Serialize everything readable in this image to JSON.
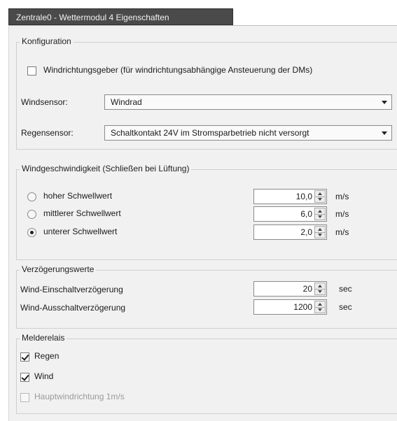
{
  "window": {
    "tab_title": "Zentrale0 - Wettermodul 4 Eigenschaften"
  },
  "konfiguration": {
    "title": "Konfiguration",
    "windrichtung_checkbox_label": "Windrichtungsgeber (für windrichtungsabhängige Ansteuerung der DMs)",
    "windrichtung_checked": false,
    "windsensor_label": "Windsensor:",
    "windsensor_value": "Windrad",
    "regensensor_label": "Regensensor:",
    "regensensor_value": "Schaltkontakt 24V im Stromsparbetrieb nicht versorgt"
  },
  "windgeschwindigkeit": {
    "title": "Windgeschwindigkeit (Schließen bei Lüftung)",
    "options": [
      {
        "label": "hoher Schwellwert",
        "value": "10,0",
        "unit": "m/s",
        "selected": false
      },
      {
        "label": "mittlerer Schwellwert",
        "value": "6,0",
        "unit": "m/s",
        "selected": false
      },
      {
        "label": "unterer Schwellwert",
        "value": "2,0",
        "unit": "m/s",
        "selected": true
      }
    ]
  },
  "verzoegerung": {
    "title": "Verzögerungswerte",
    "rows": [
      {
        "label": "Wind-Einschaltverzögerung",
        "value": "20",
        "unit": "sec"
      },
      {
        "label": "Wind-Ausschaltverzögerung",
        "value": "1200",
        "unit": "sec"
      }
    ]
  },
  "melderelais": {
    "title": "Melderelais",
    "items": [
      {
        "label": "Regen",
        "checked": true,
        "enabled": true
      },
      {
        "label": "Wind",
        "checked": true,
        "enabled": true
      },
      {
        "label": "Hauptwindrichtung 1m/s",
        "checked": false,
        "enabled": false
      }
    ]
  }
}
